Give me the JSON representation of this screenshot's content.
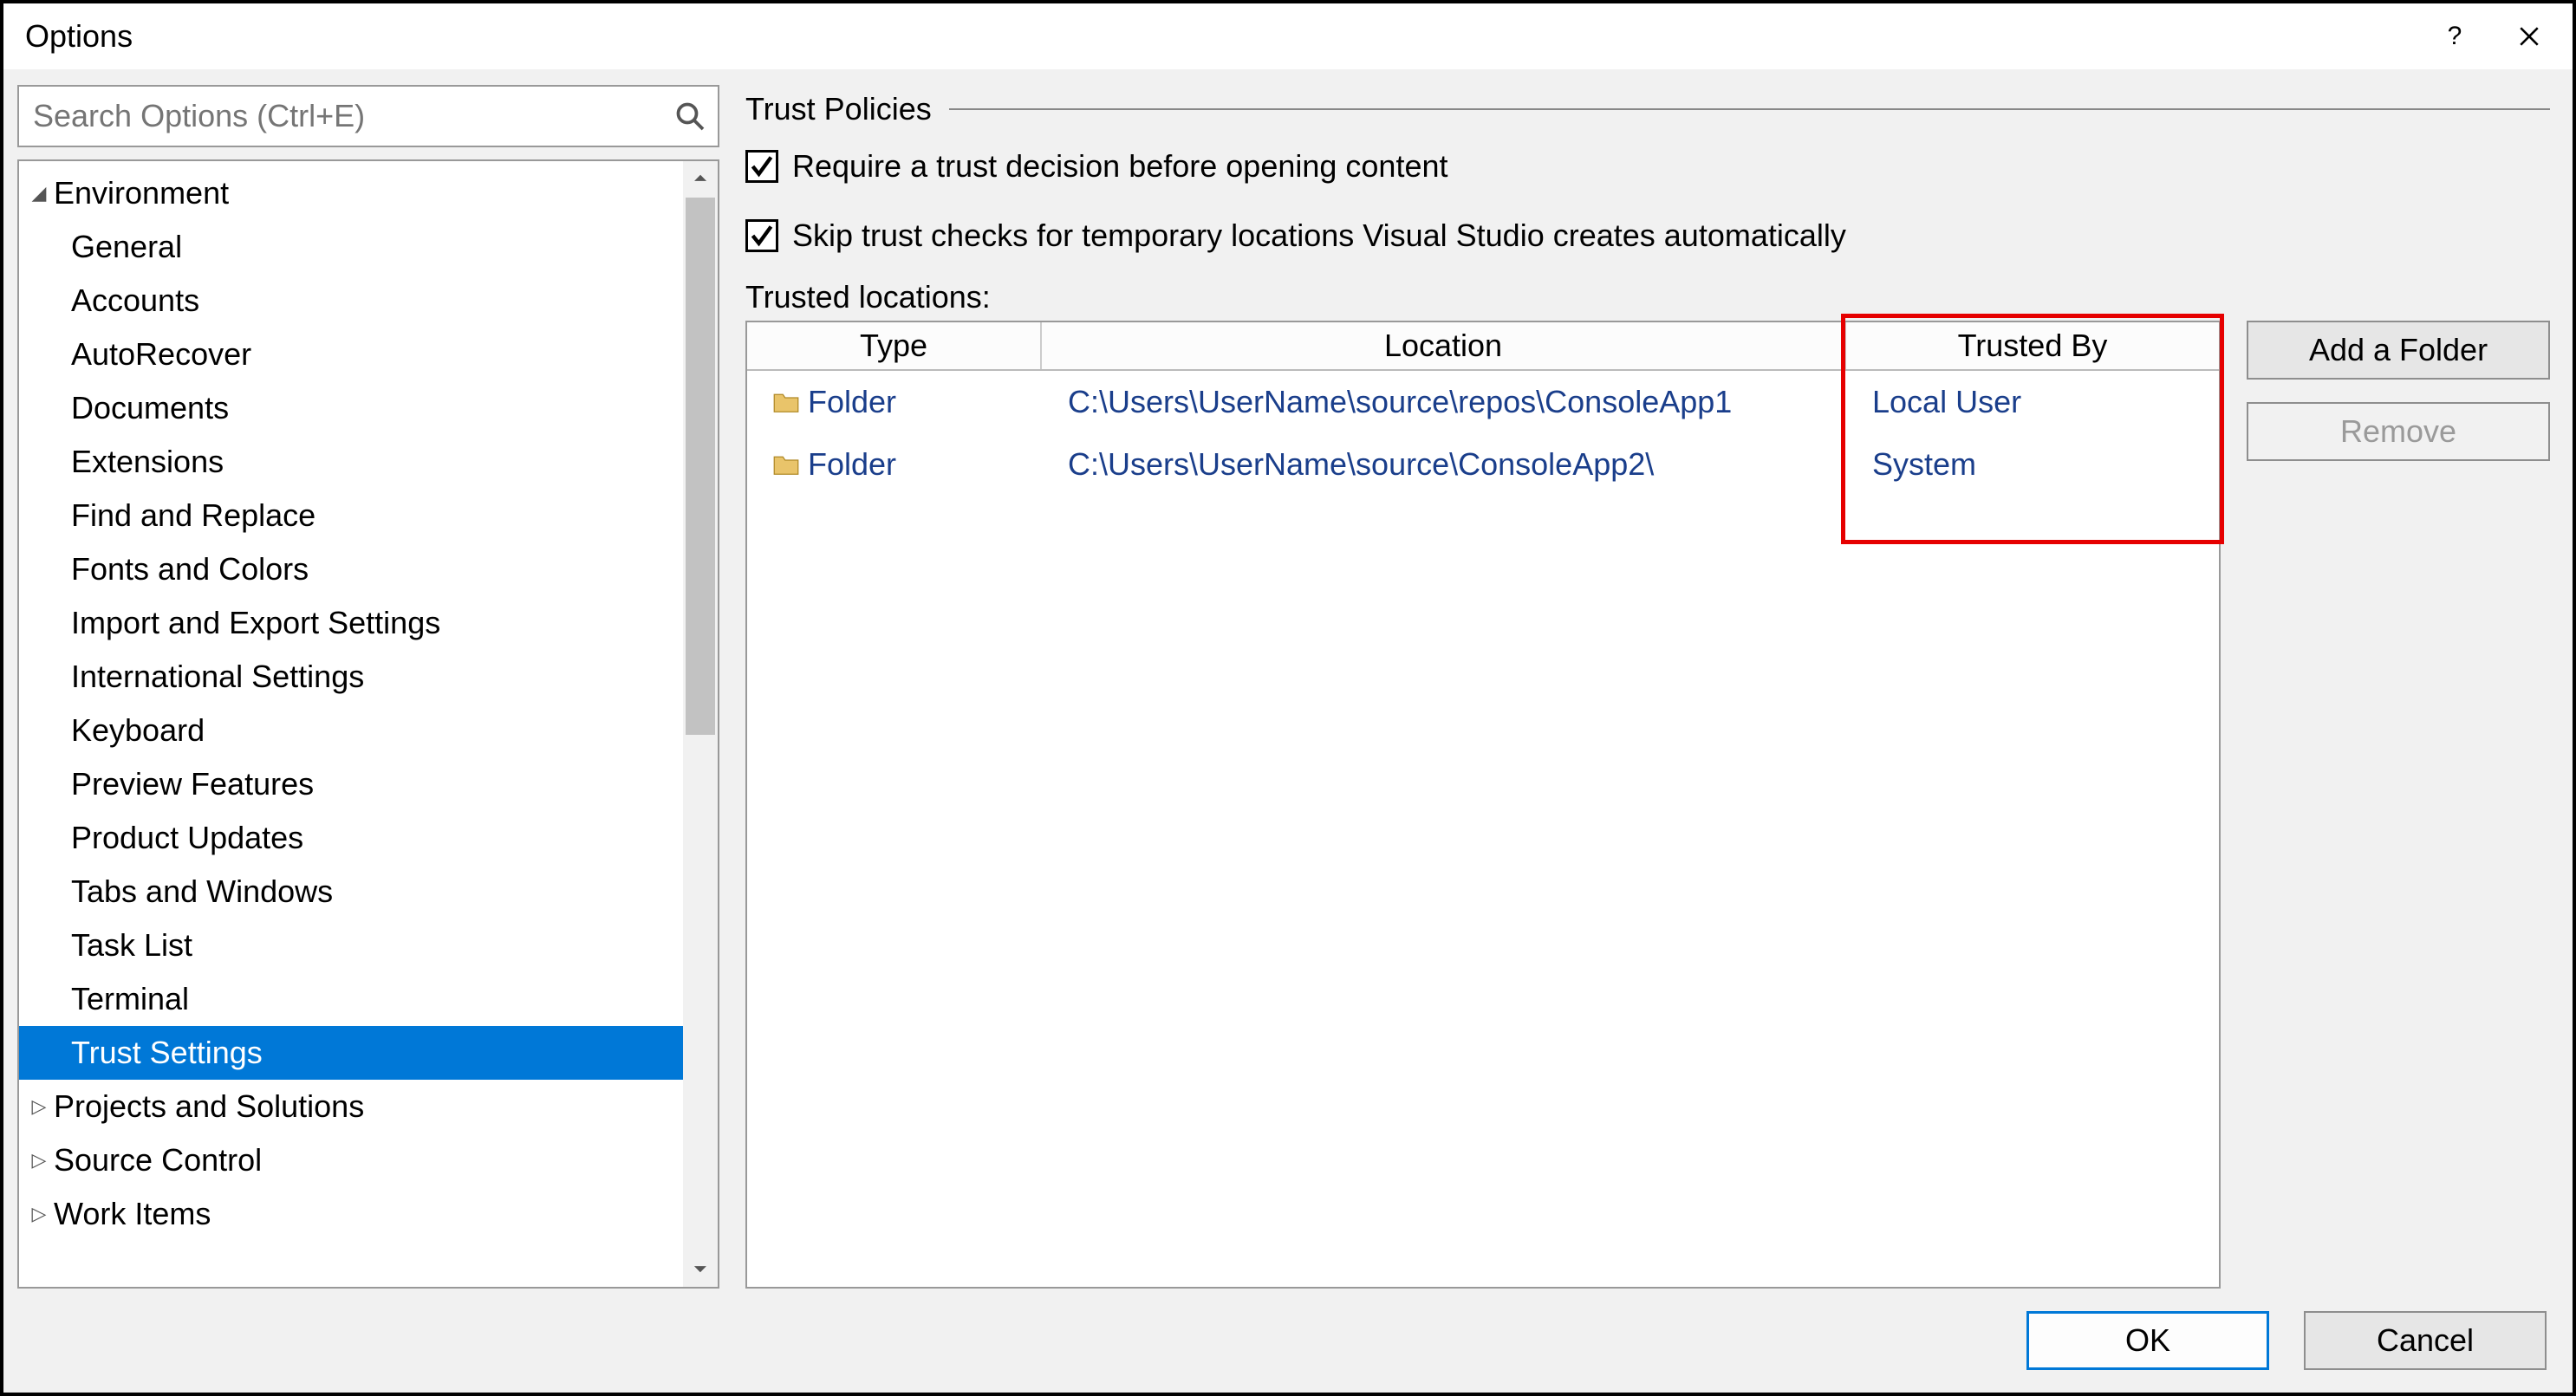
{
  "window": {
    "title": "Options"
  },
  "search": {
    "placeholder": "Search Options (Ctrl+E)"
  },
  "tree": {
    "root": "Environment",
    "items": [
      "General",
      "Accounts",
      "AutoRecover",
      "Documents",
      "Extensions",
      "Find and Replace",
      "Fonts and Colors",
      "Import and Export Settings",
      "International Settings",
      "Keyboard",
      "Preview Features",
      "Product Updates",
      "Tabs and Windows",
      "Task List",
      "Terminal",
      "Trust Settings"
    ],
    "selected": "Trust Settings",
    "collapsed": [
      "Projects and Solutions",
      "Source Control",
      "Work Items"
    ]
  },
  "group": {
    "title": "Trust Policies"
  },
  "checks": {
    "require": "Require a trust decision before opening content",
    "skip": "Skip trust checks for temporary locations Visual Studio creates automatically"
  },
  "locations_label": "Trusted locations:",
  "grid": {
    "headers": {
      "type": "Type",
      "location": "Location",
      "trustedby": "Trusted By"
    },
    "rows": [
      {
        "type": "Folder",
        "location": "C:\\Users\\UserName\\source\\repos\\ConsoleApp1",
        "trustedby": "Local User"
      },
      {
        "type": "Folder",
        "location": "C:\\Users\\UserName\\source\\ConsoleApp2\\",
        "trustedby": "System"
      }
    ]
  },
  "buttons": {
    "add_folder": "Add a Folder",
    "remove": "Remove",
    "ok": "OK",
    "cancel": "Cancel"
  }
}
